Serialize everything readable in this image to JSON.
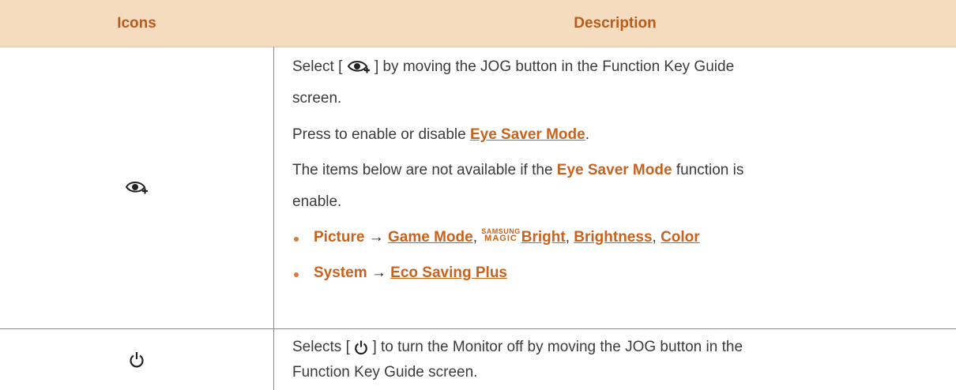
{
  "header": {
    "col1": "Icons",
    "col2": "Description"
  },
  "row1": {
    "icon": "eye-saver-icon",
    "select_prefix": "Select [",
    "select_suffix": "] by moving the JOG button in the Function Key Guide",
    "select_line2": "screen.",
    "press_prefix": "Press to enable or disable ",
    "press_link": "Eye Saver Mode",
    "press_suffix": ".",
    "items_prefix": "The items below are not available if the ",
    "items_em": "Eye Saver Mode",
    "items_suffix": " function is",
    "items_line2": "enable.",
    "bullet1": {
      "menu": "Picture",
      "arrow": " → ",
      "link1": "Game Mode",
      "sep1": ", ",
      "magic_top": "SAMSUNG",
      "magic_bottom": "MAGIC",
      "link2": "Bright",
      "sep2": ", ",
      "link3": "Brightness",
      "sep3": ", ",
      "link4": "Color"
    },
    "bullet2": {
      "menu": "System",
      "arrow": " → ",
      "link1": "Eco Saving Plus"
    }
  },
  "row2": {
    "icon": "power-icon",
    "line1_prefix": "Selects [",
    "line1_suffix": "] to turn the Monitor off by moving the JOG button in the",
    "line2": "Function Key Guide screen."
  }
}
